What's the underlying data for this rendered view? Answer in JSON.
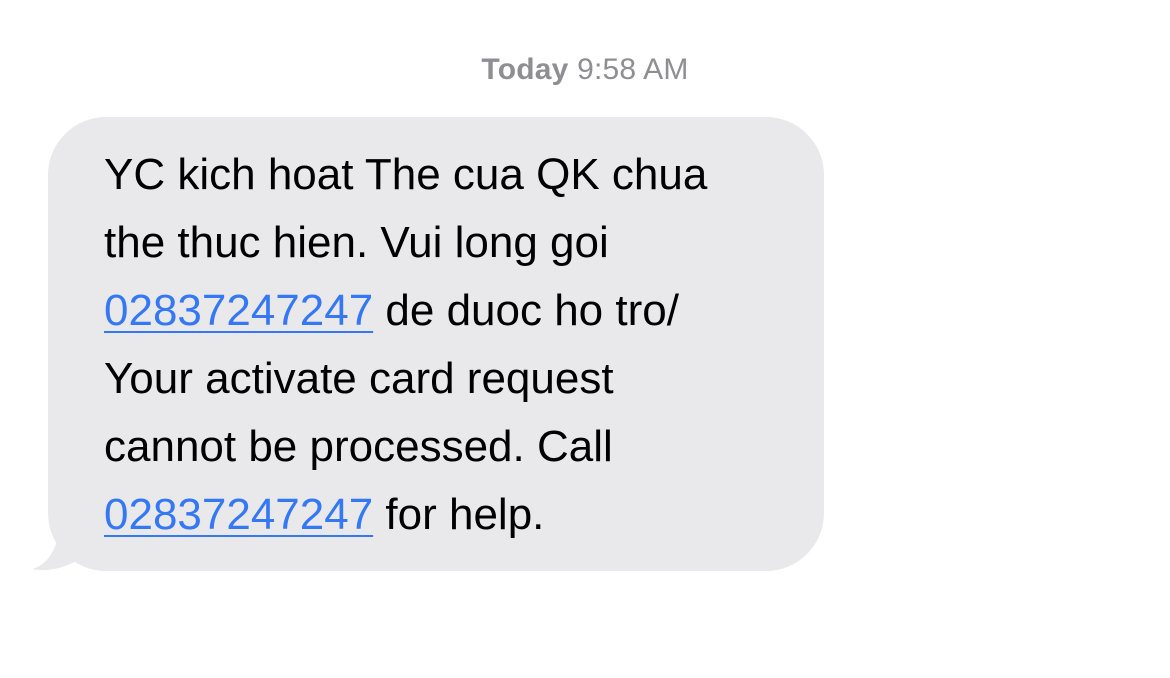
{
  "timestamp": {
    "day": "Today",
    "time": "9:58 AM"
  },
  "message": {
    "line1": "YC kich hoat The cua QK chua",
    "line2": "the thuc hien. Vui long goi",
    "phone_link_1": "02837247247",
    "line3_rest": " de duoc ho tro/",
    "line4": "Your activate card request",
    "line5": "cannot be processed. Call",
    "phone_link_2": "02837247247",
    "line6_rest": " for help."
  },
  "colors": {
    "bubble_background": "#e9e9eb",
    "link": "#3478f6",
    "timestamp": "#8e8e93",
    "text": "#000000"
  }
}
